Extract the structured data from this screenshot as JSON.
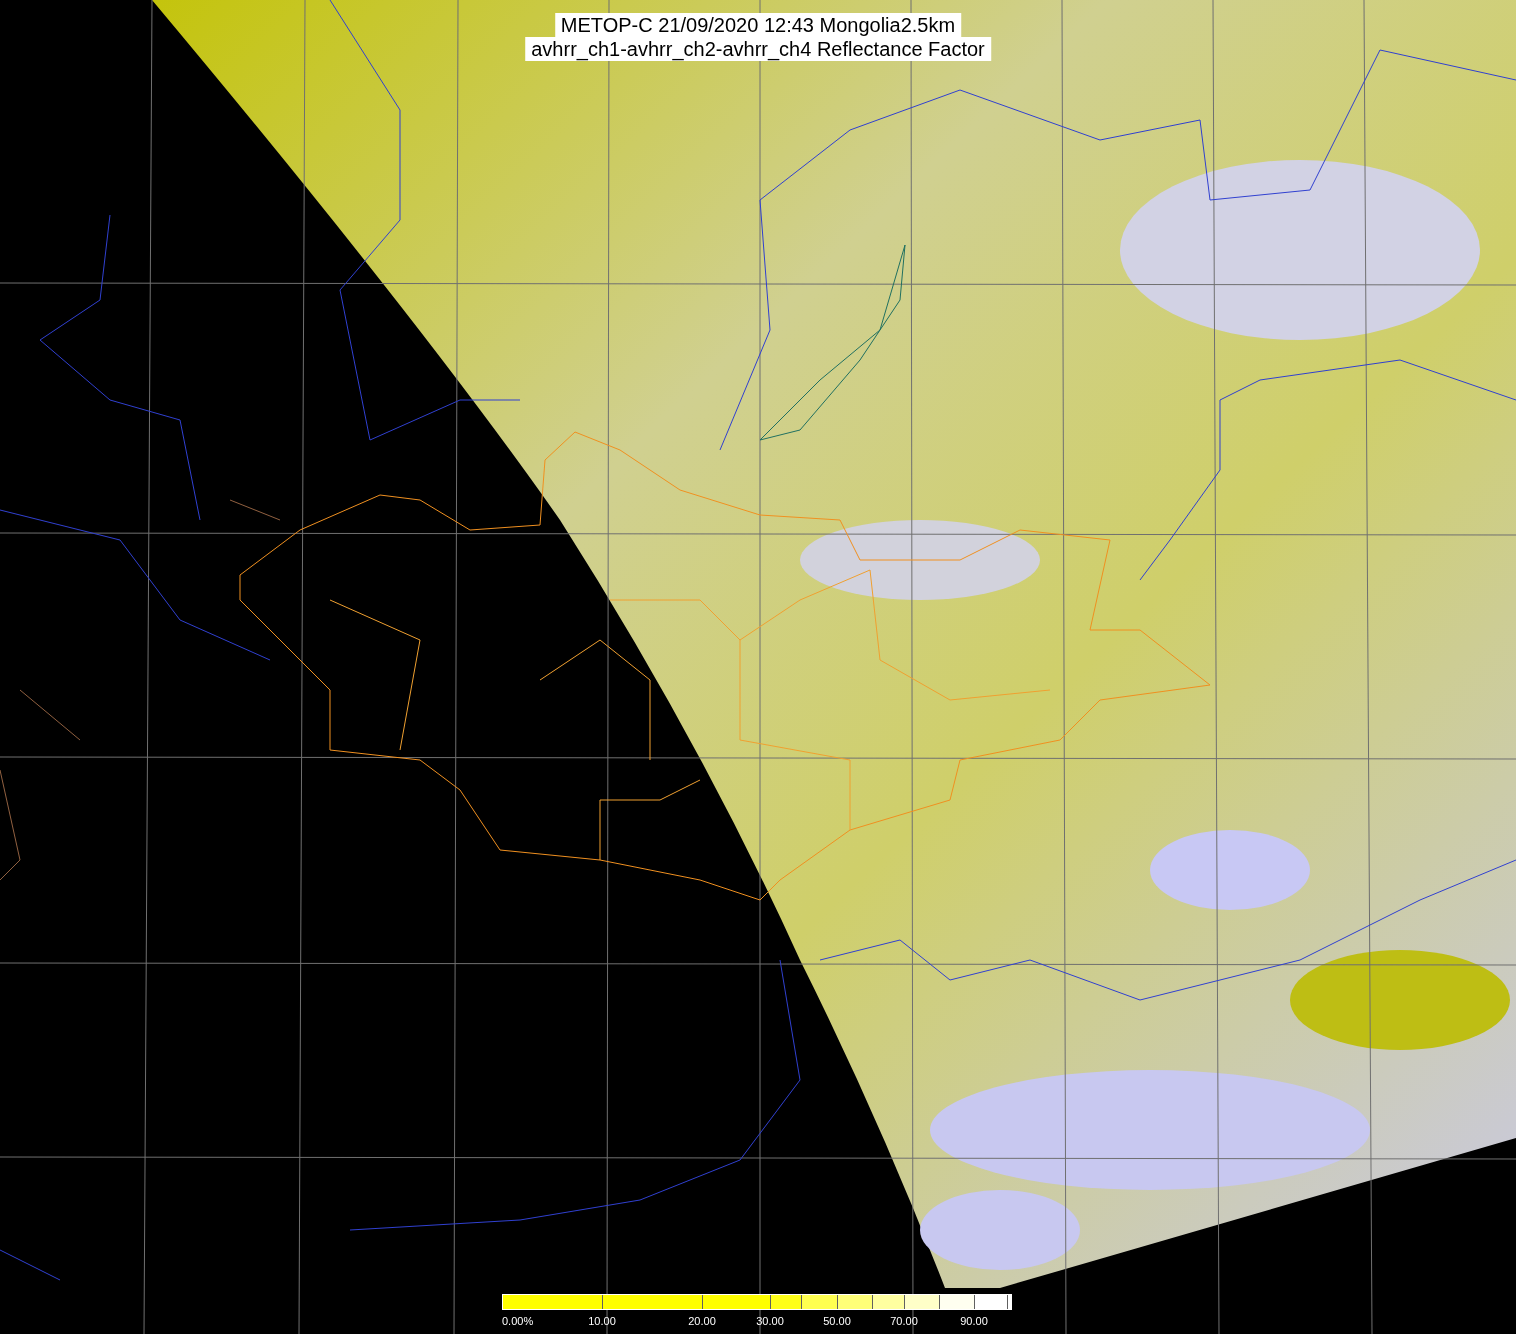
{
  "title": {
    "lines": [
      "METOP-C 21/09/2020 12:43 Mongolia2.5km",
      "avhrr_ch1-avhrr_ch2-avhrr_ch4 Reflectance Factor"
    ]
  },
  "colorbar": {
    "segments": [
      {
        "color": "#ffff00",
        "label": "0.00%"
      },
      {
        "color": "#ffff00",
        "label": "10.00"
      },
      {
        "color": "#ffff00",
        "label": "20.00"
      },
      {
        "color": "#ffff18",
        "label": "30.00"
      },
      {
        "color": "#ffff50"
      },
      {
        "color": "#ffff78",
        "label": "50.00"
      },
      {
        "color": "#ffffa0"
      },
      {
        "color": "#ffffc8",
        "label": "70.00"
      },
      {
        "color": "#fffff0"
      },
      {
        "color": "#ffffff",
        "label": "90.00"
      }
    ]
  }
}
